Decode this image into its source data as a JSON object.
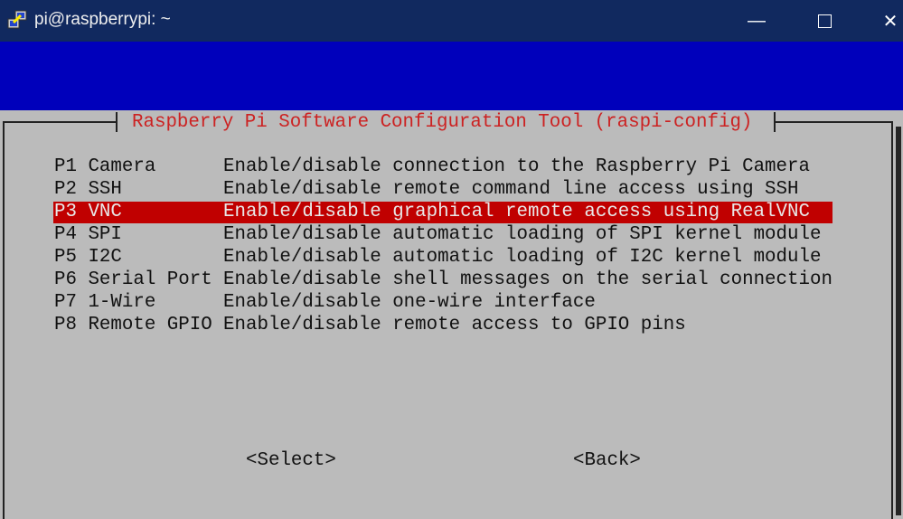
{
  "window": {
    "title": "pi@raspberrypi: ~",
    "icon": "putty-icon",
    "controls": [
      "minimize",
      "maximize",
      "close"
    ]
  },
  "dialog": {
    "title": "Raspberry Pi Software Configuration Tool (raspi-config)",
    "selected_index": 2,
    "items": [
      {
        "key": "P1 Camera",
        "desc": "Enable/disable connection to the Raspberry Pi Camera"
      },
      {
        "key": "P2 SSH",
        "desc": "Enable/disable remote command line access using SSH"
      },
      {
        "key": "P3 VNC",
        "desc": "Enable/disable graphical remote access using RealVNC"
      },
      {
        "key": "P4 SPI",
        "desc": "Enable/disable automatic loading of SPI kernel module"
      },
      {
        "key": "P5 I2C",
        "desc": "Enable/disable automatic loading of I2C kernel module"
      },
      {
        "key": "P6 Serial Port",
        "desc": "Enable/disable shell messages on the serial connection"
      },
      {
        "key": "P7 1-Wire",
        "desc": "Enable/disable one-wire interface"
      },
      {
        "key": "P8 Remote GPIO",
        "desc": "Enable/disable remote access to GPIO pins"
      }
    ],
    "buttons": {
      "select": "<Select>",
      "back": "<Back>"
    }
  },
  "colors": {
    "titlebar": "#11295f",
    "background_blue": "#0000bb",
    "dialog_gray": "#bbbbbb",
    "highlight": "#c00000",
    "title_text": "#cc2222"
  }
}
